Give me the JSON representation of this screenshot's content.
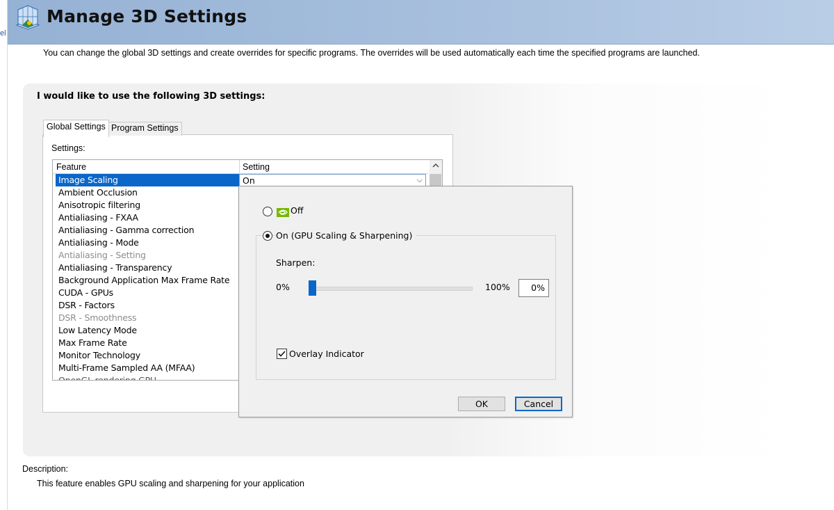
{
  "window": {
    "left_glyph": "el"
  },
  "header": {
    "title": "Manage 3D Settings",
    "icon": "nvidia-3d-settings-icon"
  },
  "intro": "You can change the global 3D settings and create overrides for specific programs. The overrides will be used automatically each time the specified programs are launched.",
  "panel": {
    "heading": "I would like to use the following 3D settings:"
  },
  "tabs": [
    {
      "label": "Global Settings",
      "active": true
    },
    {
      "label": "Program Settings",
      "active": false
    }
  ],
  "settings_label": "Settings:",
  "grid": {
    "headers": {
      "feature": "Feature",
      "setting": "Setting"
    },
    "rows": [
      {
        "label": "Image Scaling",
        "selected": true
      },
      {
        "label": "Ambient Occlusion"
      },
      {
        "label": "Anisotropic filtering"
      },
      {
        "label": "Antialiasing - FXAA"
      },
      {
        "label": "Antialiasing - Gamma correction"
      },
      {
        "label": "Antialiasing - Mode"
      },
      {
        "label": "Antialiasing - Setting",
        "disabled": true
      },
      {
        "label": "Antialiasing - Transparency"
      },
      {
        "label": "Background Application Max Frame Rate"
      },
      {
        "label": "CUDA - GPUs"
      },
      {
        "label": "DSR - Factors"
      },
      {
        "label": "DSR - Smoothness",
        "disabled": true
      },
      {
        "label": "Low Latency Mode"
      },
      {
        "label": "Max Frame Rate"
      },
      {
        "label": "Monitor Technology"
      },
      {
        "label": "Multi-Frame Sampled AA (MFAA)"
      },
      {
        "label": "OpenGL rendering GPU",
        "partial": true
      }
    ],
    "selected_value": "On"
  },
  "popup": {
    "off_label": "Off",
    "on_label": "On (GPU Scaling & Sharpening)",
    "selected": "on",
    "sharpen_label": "Sharpen:",
    "slider_min": "0%",
    "slider_max": "100%",
    "sharpen_value": "0%",
    "sharpen_fraction": 0.0,
    "overlay_label": "Overlay Indicator",
    "overlay_checked": true,
    "ok_label": "OK",
    "cancel_label": "Cancel"
  },
  "description": {
    "label": "Description:",
    "text": "This feature enables GPU scaling and sharpening for your application"
  },
  "colors": {
    "accent": "#0a66c8",
    "header": "#a9c1de",
    "nvidia_green": "#76b900"
  }
}
